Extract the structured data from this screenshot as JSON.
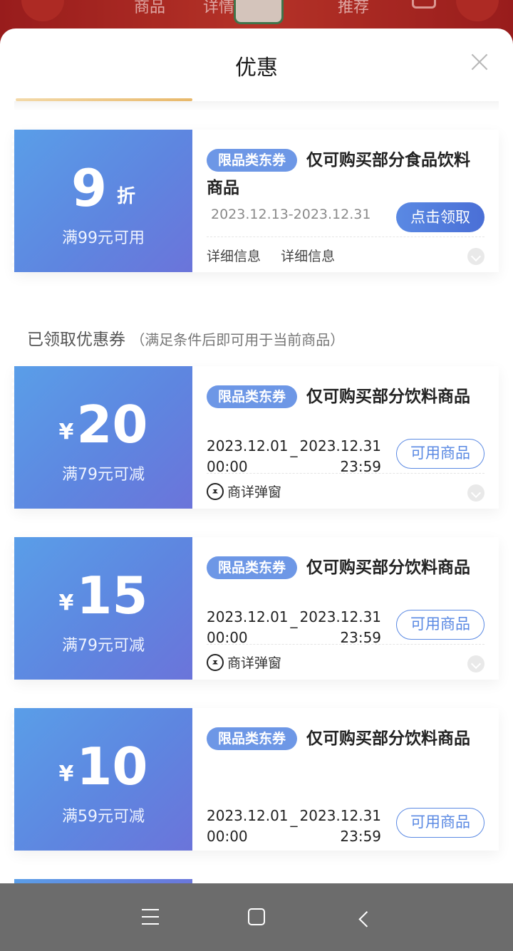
{
  "background": {
    "tabs": [
      "商品",
      "详情",
      "推荐"
    ]
  },
  "sheet": {
    "title": "优惠",
    "close_icon": "close-icon"
  },
  "unclaimed": [
    {
      "value": "9",
      "unit": "折",
      "threshold": "满99元可用",
      "tag": "限品类东券",
      "desc": "仅可购买部分食品饮料商品",
      "date": "2023.12.13-2023.12.31",
      "action": "点击领取",
      "details": [
        "详细信息",
        "详细信息"
      ]
    }
  ],
  "section": {
    "title": "已领取优惠券",
    "subtitle": "（满足条件后即可用于当前商品）"
  },
  "claimed": [
    {
      "currency": "¥",
      "value": "20",
      "threshold": "满79元可减",
      "tag": "限品类东券",
      "desc": "仅可购买部分饮料商品",
      "start_date": "2023.12.01",
      "start_time": "00:00",
      "end_date": "2023.12.31",
      "end_time": "23:59",
      "separator": "_",
      "action": "可用商品",
      "popup": "商详弹窗"
    },
    {
      "currency": "¥",
      "value": "15",
      "threshold": "满79元可减",
      "tag": "限品类东券",
      "desc": "仅可购买部分饮料商品",
      "start_date": "2023.12.01",
      "start_time": "00:00",
      "end_date": "2023.12.31",
      "end_time": "23:59",
      "separator": "_",
      "action": "可用商品",
      "popup": "商详弹窗"
    },
    {
      "currency": "¥",
      "value": "10",
      "threshold": "满59元可减",
      "tag": "限品类东券",
      "desc": "仅可购买部分饮料商品",
      "start_date": "2023.12.01",
      "start_time": "00:00",
      "end_date": "2023.12.31",
      "end_time": "23:59",
      "separator": "_",
      "action": "可用商品"
    }
  ],
  "colors": {
    "accent": "#5a89e3",
    "coupon_gradient_start": "#5a9ee8",
    "coupon_gradient_end": "#6b74da",
    "tab_indicator": "#e8b86a"
  },
  "navbar": {
    "icons": [
      "menu-icon",
      "home-icon",
      "back-icon"
    ]
  }
}
